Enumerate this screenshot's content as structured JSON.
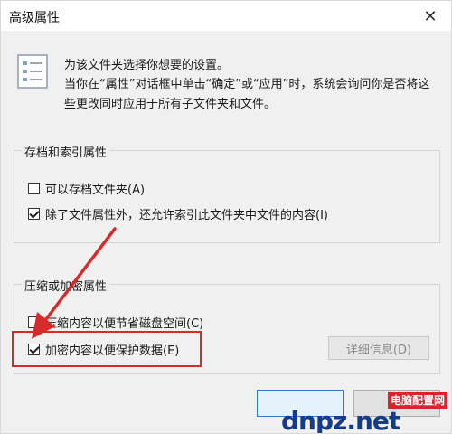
{
  "window": {
    "title": "高级属性",
    "close_glyph": "✕"
  },
  "intro": {
    "line1": "为该文件夹选择你想要的设置。",
    "line2": "当你在“属性”对话框中单击“确定”或“应用”时，系统会询问你是否将这些更改同时应用于所有子文件夹和文件。"
  },
  "archive_group": {
    "legend": "存档和索引属性",
    "archive_label": "可以存档文件夹(A)",
    "archive_checked": false,
    "index_label": "除了文件属性外，还允许索引此文件夹中文件的内容(I)",
    "index_checked": true
  },
  "compress_group": {
    "legend": "压缩或加密属性",
    "compress_label": "压缩内容以便节省磁盘空间(C)",
    "compress_checked": false,
    "encrypt_label": "加密内容以便保护数据(E)",
    "encrypt_checked": true,
    "details_label": "详细信息(D)"
  },
  "watermark": {
    "top_text": "电脑配置网",
    "main_text": "dnpz.net"
  },
  "colors": {
    "highlight": "#d52b2b",
    "watermark_blue": "#153c8a",
    "watermark_red": "#e0202a"
  },
  "icons": {
    "folder_settings": "list-settings-icon",
    "close": "close-icon"
  }
}
